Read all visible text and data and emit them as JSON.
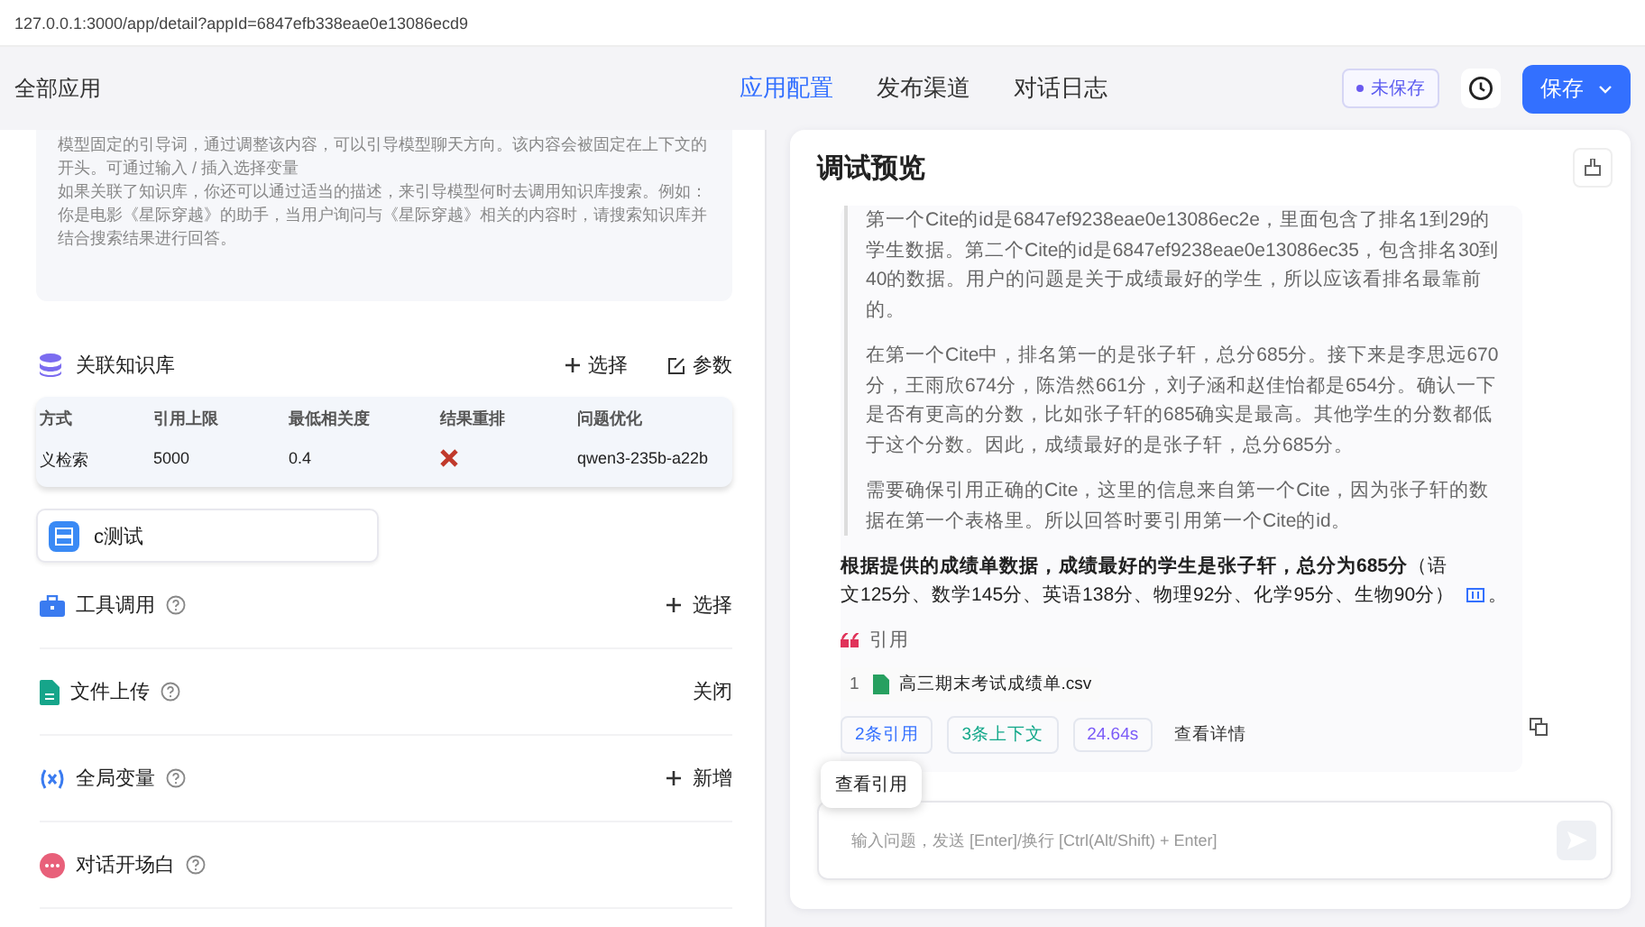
{
  "url": "127.0.0.1:3000/app/detail?appId=6847efb338eae0e13086ecd9",
  "header": {
    "back": "全部应用",
    "tabs": [
      {
        "label": "应用配置",
        "selected": true
      },
      {
        "label": "发布渠道",
        "selected": false
      },
      {
        "label": "对话日志",
        "selected": false
      }
    ],
    "save_status": "未保存",
    "save_button": "保存"
  },
  "prompt_hint": [
    "模型固定的引导词，通过调整该内容，可以引导模型聊天方向。该内容会被固定在上下文的开头。可通过输入 / 插入选择变量",
    "如果关联了知识库，你还可以通过适当的描述，来引导模型何时去调用知识库搜索。例如：",
    "你是电影《星际穿越》的助手，当用户询问与《星际穿越》相关的内容时，请搜索知识库并结合搜索结果进行回答。"
  ],
  "knowledge": {
    "title": "关联知识库",
    "select": "选择",
    "params": "参数",
    "columns": [
      "方式",
      "引用上限",
      "最低相关度",
      "结果重排",
      "问题优化"
    ],
    "row": {
      "mode": "义检索",
      "limit": "5000",
      "similarity": "0.4",
      "rerank": false,
      "optimize": "qwen3-235b-a22b"
    },
    "datasets": [
      {
        "name": "c测试"
      }
    ]
  },
  "sections": [
    {
      "kind": "tools",
      "title": "工具调用",
      "action": {
        "kind": "add",
        "label": "选择"
      }
    },
    {
      "kind": "file",
      "title": "文件上传",
      "action": {
        "kind": "plain",
        "label": "关闭"
      }
    },
    {
      "kind": "variables",
      "title": "全局变量",
      "action": {
        "kind": "add",
        "label": "新增"
      }
    },
    {
      "kind": "welcome",
      "title": "对话开场白"
    }
  ],
  "chat": {
    "title": "调试预览",
    "thinking": [
      "第一个Cite的id是6847ef9238eae0e13086ec2e，里面包含了排名1到29的学生数据。第二个Cite的id是6847ef9238eae0e13086ec35，包含排名30到40的数据。用户的问题是关于成绩最好的学生，所以应该看排名最靠前的。",
      "在第一个Cite中，排名第一的是张子轩，总分685分。接下来是李思远670分，王雨欣674分，陈浩然661分，刘子涵和赵佳怡都是654分。确认一下是否有更高的分数，比如张子轩的685确实是最高。其他学生的分数都低于这个分数。因此，成绩最好的是张子轩，总分685分。",
      "需要确保引用正确的Cite，这里的信息来自第一个Cite，因为张子轩的数据在第一个表格里。所以回答时要引用第一个Cite的id。"
    ],
    "answer": "**根据提供的成绩单数据，成绩最好的学生是张子轩，总分为685分**（语文125分、数学145分、英语138分、物理92分、化学95分、生物90分）",
    "answer_end": "。",
    "quote_label": "引用",
    "citations": [
      {
        "index": "1",
        "file": "高三期末考试成绩单.csv"
      }
    ],
    "tags": [
      {
        "label": "2条引用",
        "color": "#3370ff"
      },
      {
        "label": "3条上下文",
        "color": "#13a88a"
      },
      {
        "label": "24.64s",
        "color": "#7a5af8"
      }
    ],
    "detail": "查看详情",
    "tooltip": "查看引用",
    "input_placeholder": "输入问题，发送 [Enter]/换行 [Ctrl(Alt/Shift) + Enter]"
  }
}
